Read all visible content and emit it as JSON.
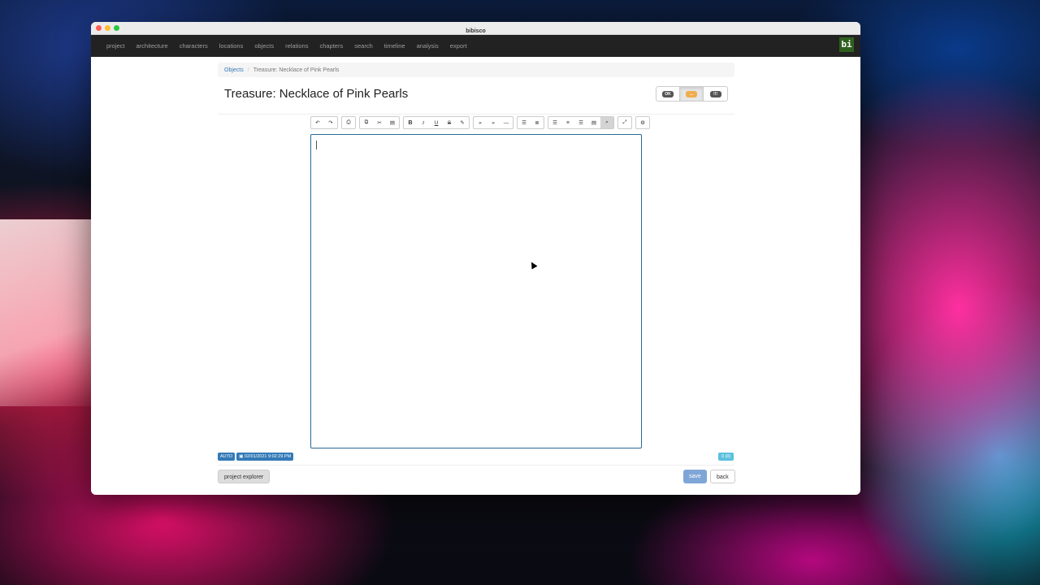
{
  "window": {
    "title": "bibisco"
  },
  "navbar": {
    "items": [
      "project",
      "architecture",
      "characters",
      "locations",
      "objects",
      "relations",
      "chapters",
      "search",
      "timeline",
      "analysis",
      "export"
    ],
    "brand": "bi"
  },
  "breadcrumb": {
    "parent": "Objects",
    "separator": "/",
    "current": "Treasure: Necklace of Pink Pearls"
  },
  "page": {
    "title": "Treasure: Necklace of Pink Pearls"
  },
  "status": {
    "ok": "OK",
    "wip": "...",
    "todo": "!!!",
    "selected": "wip"
  },
  "toolbar": {
    "groups": [
      [
        "undo-icon",
        "redo-icon"
      ],
      [
        "print-icon"
      ],
      [
        "copy-icon",
        "cut-icon",
        "paste-icon"
      ],
      [
        "bold-icon",
        "italic-icon",
        "underline-icon",
        "strikethrough-icon",
        "highlight-icon"
      ],
      [
        "left-quote-icon",
        "right-quote-icon",
        "dash-icon"
      ],
      [
        "ordered-list-icon",
        "unordered-list-icon"
      ],
      [
        "align-left-icon",
        "align-center-icon",
        "align-right-icon",
        "align-justify-icon",
        "search-icon"
      ],
      [
        "fullscreen-icon"
      ],
      [
        "settings-icon"
      ]
    ],
    "labels": {
      "bold": "B",
      "italic": "I",
      "underline": "U",
      "strike": "S"
    }
  },
  "footer": {
    "autosave": "AUTO",
    "saved_timestamp": "02/01/2021 9:02:29 PM",
    "word_count": "0 (0)"
  },
  "buttons": {
    "project_explorer": "project explorer",
    "save": "save",
    "back": "back"
  },
  "colors": {
    "navbar": "#222222",
    "link": "#337ab7",
    "wip": "#f0ad4e",
    "editor_border": "#2a6a95"
  }
}
